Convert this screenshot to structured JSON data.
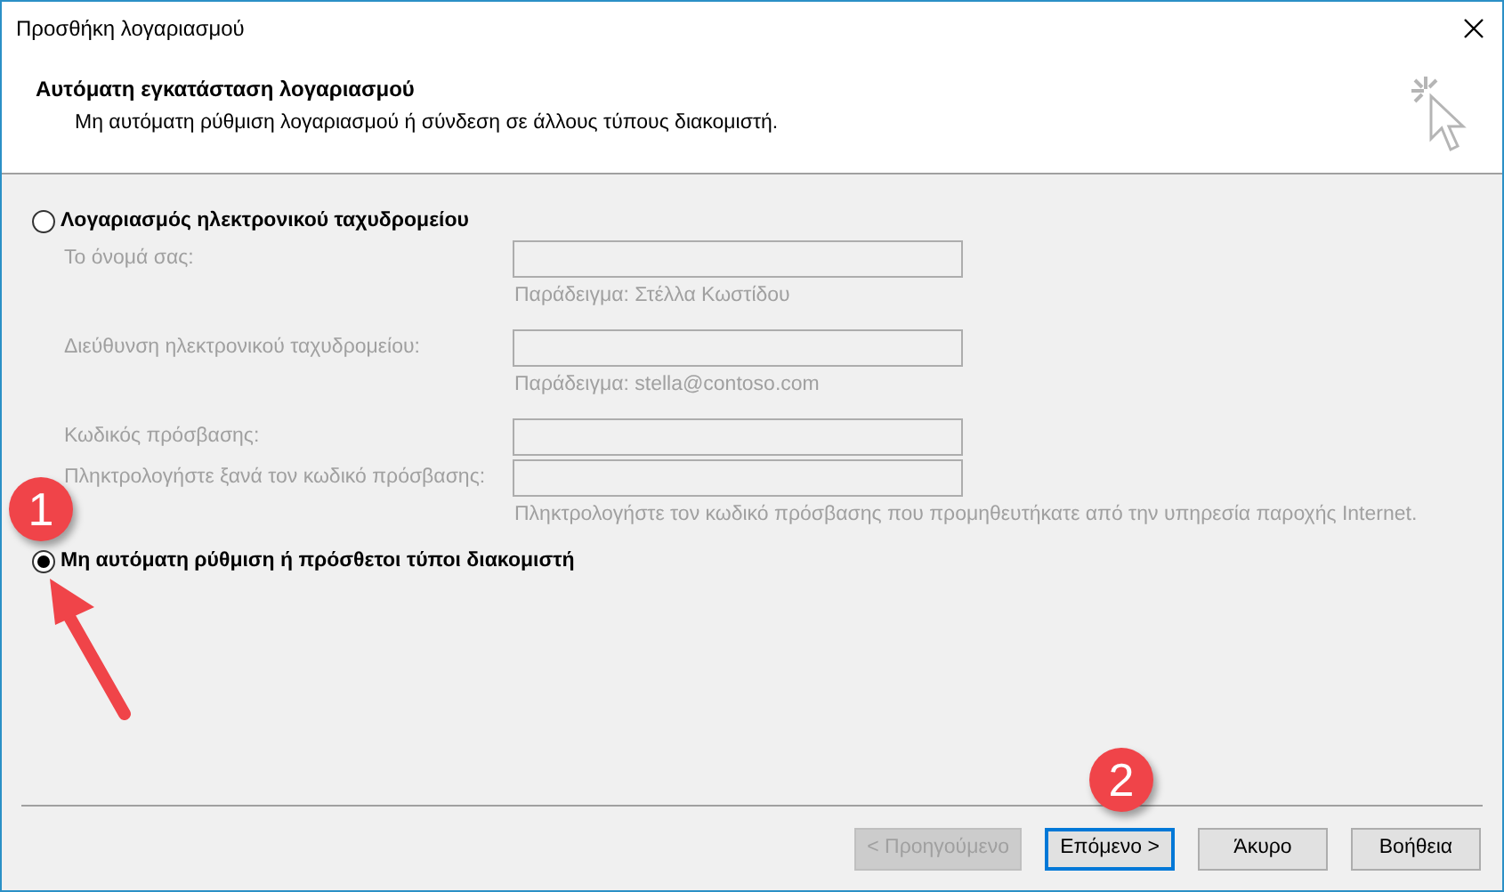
{
  "window": {
    "title": "Προσθήκη λογαριασμού"
  },
  "header": {
    "title": "Αυτόματη εγκατάσταση λογαριασμού",
    "subtitle": "Μη αυτόματη ρύθμιση λογαριασμού ή σύνδεση σε άλλους τύπους διακομιστή."
  },
  "options": [
    {
      "label": "Λογαριασμός ηλεκτρονικού ταχυδρομείου",
      "selected": false,
      "fields": [
        {
          "label": "Το όνομά σας:",
          "hint": "Παράδειγμα: Στέλλα Κωστίδου"
        },
        {
          "label": "Διεύθυνση ηλεκτρονικού ταχυδρομείου:",
          "hint": "Παράδειγμα: stella@contoso.com"
        },
        {
          "label": "Κωδικός πρόσβασης:"
        },
        {
          "label": "Πληκτρολογήστε ξανά τον κωδικό πρόσβασης:",
          "hint": "Πληκτρολογήστε τον κωδικό πρόσβασης που προμηθευτήκατε από την υπηρεσία παροχής Internet."
        }
      ]
    },
    {
      "label": "Μη αυτόματη ρύθμιση ή πρόσθετοι τύποι διακομιστή",
      "selected": true
    }
  ],
  "buttons": [
    {
      "label": "< Προηγούμενο",
      "disabled": true,
      "focused": false
    },
    {
      "label": "Επόμενο >",
      "disabled": false,
      "focused": true
    },
    {
      "label": "Άκυρο",
      "disabled": false,
      "focused": false
    },
    {
      "label": "Βοήθεια",
      "disabled": false,
      "focused": false
    }
  ],
  "annotations": [
    {
      "number": "1",
      "arrow": true
    },
    {
      "number": "2",
      "arrow": false
    }
  ]
}
